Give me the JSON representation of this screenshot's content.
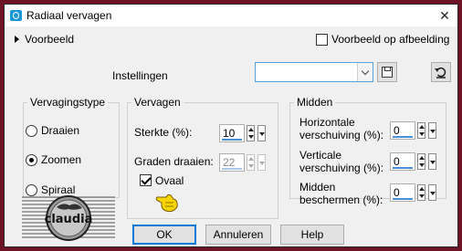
{
  "window": {
    "title": "Radiaal vervagen",
    "close_glyph": "✕"
  },
  "preview": {
    "toggle_label": "Voorbeeld",
    "checkbox_label": "Voorbeeld op afbeelding",
    "checkbox_checked": false
  },
  "settings": {
    "label": "Instellingen",
    "combo_value": "",
    "save_icon": "floppy-disk-icon",
    "reset_icon": "reset-arrow-icon"
  },
  "type_group": {
    "legend": "Vervagingstype",
    "options": [
      {
        "label": "Draaien",
        "selected": false
      },
      {
        "label": "Zoomen",
        "selected": true
      },
      {
        "label": "Spiraal",
        "selected": false
      }
    ]
  },
  "fade_group": {
    "legend": "Vervagen",
    "strength_label": "Sterkte (%):",
    "strength_value": "10",
    "rotate_label": "Graden draaien:",
    "rotate_value": "22",
    "oval_label": "Ovaal",
    "oval_checked": true
  },
  "middle_group": {
    "legend": "Midden",
    "horizontal_label": [
      "Horizontale",
      "verschuiving (%):"
    ],
    "horizontal_value": "0",
    "vertical_label": [
      "Verticale",
      "verschuiving (%):"
    ],
    "vertical_value": "0",
    "protect_label": [
      "Midden",
      "beschermen (%):"
    ],
    "protect_value": "0"
  },
  "logo": {
    "text": "claudia"
  },
  "buttons": {
    "ok": "OK",
    "cancel": "Annuleren",
    "help": "Help"
  },
  "colors": {
    "background": "#6e1226",
    "dialog": "#f0f0f0",
    "accent": "#0078d7",
    "hand": "#f7d500"
  }
}
